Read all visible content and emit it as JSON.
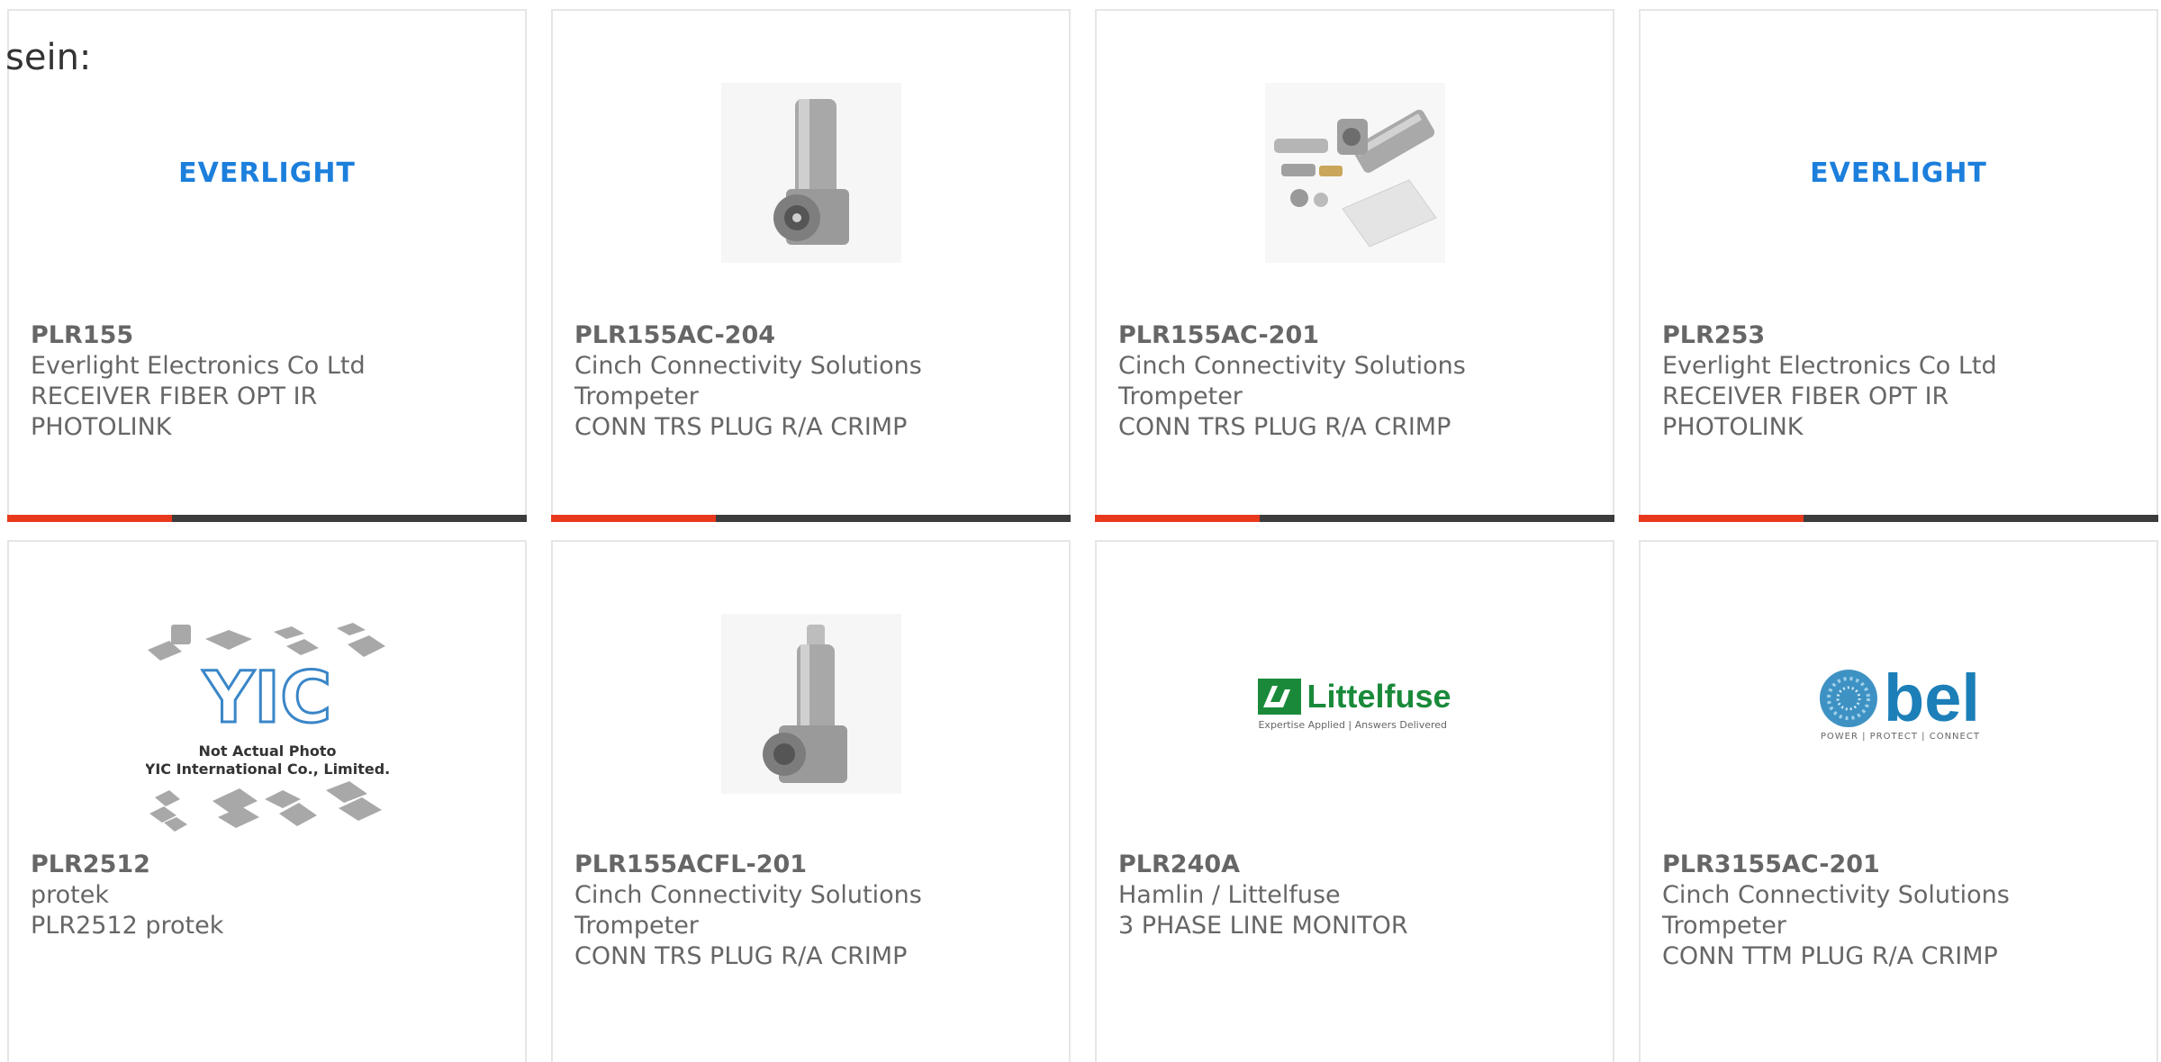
{
  "intro": "sein:",
  "products": [
    {
      "pn": "PLR155",
      "mfr": "Everlight Electronics Co Ltd",
      "desc": [
        "RECEIVER FIBER OPT IR",
        "PHOTOLINK"
      ],
      "image": "everlight-logo"
    },
    {
      "pn": "PLR155AC-204",
      "mfr": "Cinch Connectivity Solutions",
      "desc": [
        "Trompeter",
        "CONN TRS PLUG R/A CRIMP"
      ],
      "image": "connector-photo"
    },
    {
      "pn": "PLR155AC-201",
      "mfr": "Cinch Connectivity Solutions",
      "desc": [
        "Trompeter",
        "CONN TRS PLUG R/A CRIMP"
      ],
      "image": "connector-kit-photo"
    },
    {
      "pn": "PLR253",
      "mfr": "Everlight Electronics Co Ltd",
      "desc": [
        "RECEIVER FIBER OPT IR",
        "PHOTOLINK"
      ],
      "image": "everlight-logo"
    },
    {
      "pn": "PLR2512",
      "mfr": "protek",
      "desc": [
        "PLR2512 protek"
      ],
      "image": "yic-placeholder"
    },
    {
      "pn": "PLR155ACFL-201",
      "mfr": "Cinch Connectivity Solutions",
      "desc": [
        "Trompeter",
        "CONN TRS PLUG R/A CRIMP"
      ],
      "image": "connector-photo"
    },
    {
      "pn": "PLR240A",
      "mfr": "Hamlin / Littelfuse",
      "desc": [
        "3 PHASE LINE MONITOR"
      ],
      "image": "littelfuse-logo"
    },
    {
      "pn": "PLR3155AC-201",
      "mfr": "Cinch Connectivity Solutions",
      "desc": [
        "Trompeter",
        "CONN TTM PLUG R/A CRIMP"
      ],
      "image": "bel-logo"
    }
  ],
  "logos": {
    "everlight": "EVERLIGHT",
    "littelfuse": "Littelfuse",
    "littelfuse_tagline": "Expertise Applied | Answers Delivered",
    "bel": "bel",
    "bel_tagline": "POWER | PROTECT | CONNECT",
    "yic_brand": "YIC",
    "yic_line1": "Not Actual Photo",
    "yic_line2": "YIC International Co., Limited."
  },
  "colors": {
    "accent": "#e8391d",
    "bar": "#3c3c3c",
    "text": "#666666",
    "border": "#e6e6e6",
    "everlight": "#1c7fdc",
    "littelfuse": "#1a8a3a",
    "bel": "#1c7fb8"
  }
}
